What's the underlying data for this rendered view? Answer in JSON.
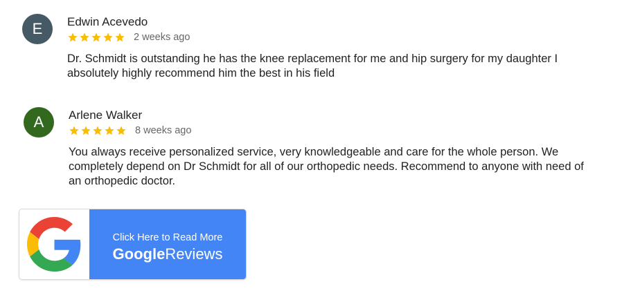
{
  "reviews": [
    {
      "avatar_letter": "E",
      "avatar_color": "#455a64",
      "name": "Edwin Acevedo",
      "rating": 5,
      "time": "2 weeks ago",
      "text": "Dr. Schmidt is outstanding he has the knee replacement for me and hip surgery for my daughter I absolutely highly recommend him the best in his field"
    },
    {
      "avatar_letter": "A",
      "avatar_color": "#33691e",
      "name": "Arlene Walker",
      "rating": 5,
      "time": "8 weeks ago",
      "text": "You always receive personalized service, very knowledgeable and care for the whole person. We completely depend on Dr Schmidt for all of our orthopedic needs. Recommend to anyone with need of an orthopedic doctor."
    }
  ],
  "star_color": "#fbbc04",
  "google_button": {
    "line1": "Click Here to Read More",
    "brand": "Google",
    "word": "Reviews",
    "background": "#4385f4",
    "icon": "google-g-icon"
  }
}
